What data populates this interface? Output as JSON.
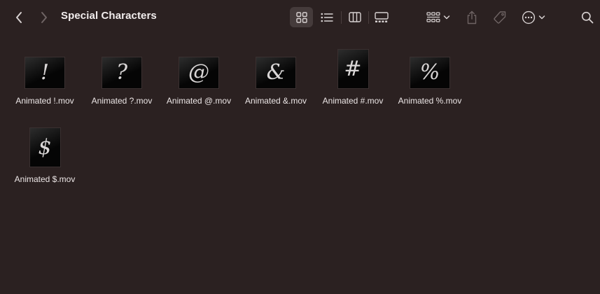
{
  "window": {
    "title": "Special Characters"
  },
  "toolbar": {
    "back_icon": "chevron-left-icon",
    "forward_icon": "chevron-right-icon",
    "views": [
      {
        "name": "icon-view",
        "icon": "grid-icon",
        "active": true
      },
      {
        "name": "list-view",
        "icon": "list-icon",
        "active": false
      },
      {
        "name": "column-view",
        "icon": "columns-icon",
        "active": false
      },
      {
        "name": "gallery-view",
        "icon": "gallery-icon",
        "active": false
      }
    ],
    "group_icon": "group-by-icon",
    "share_icon": "share-icon",
    "tag_icon": "tag-icon",
    "more_icon": "ellipsis-circle-icon",
    "search_icon": "search-icon"
  },
  "files": [
    {
      "name": "Animated !.mov",
      "glyph": "!",
      "orientation": "landscape"
    },
    {
      "name": "Animated ?.mov",
      "glyph": "?",
      "orientation": "landscape"
    },
    {
      "name": "Animated @.mov",
      "glyph": "@",
      "orientation": "landscape"
    },
    {
      "name": "Animated &.mov",
      "glyph": "&",
      "orientation": "landscape"
    },
    {
      "name": "Animated #.mov",
      "glyph": "#",
      "orientation": "portrait"
    },
    {
      "name": "Animated %.mov",
      "glyph": "%",
      "orientation": "landscape"
    },
    {
      "name": "Animated $.mov",
      "glyph": "$",
      "orientation": "portrait"
    }
  ],
  "colors": {
    "background": "#2b2121",
    "toolbar_icon": "#d8d2d2",
    "disabled_icon": "#6f6464",
    "active_view_bg": "#453b3b",
    "thumbnail_bg": "#050505"
  }
}
